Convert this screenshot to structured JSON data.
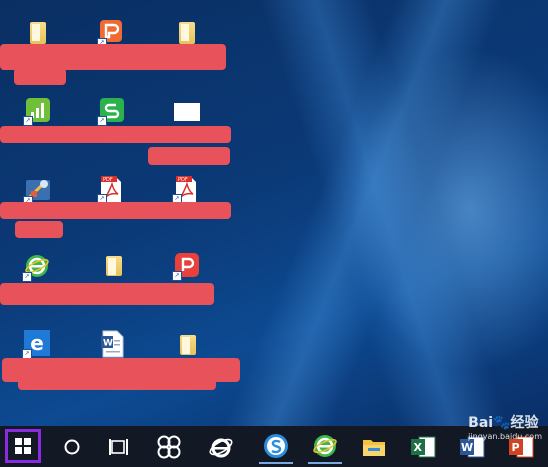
{
  "desktop": {
    "icons": [
      {
        "name": "folder",
        "shortcut": false
      },
      {
        "name": "wps-writer",
        "shortcut": true
      },
      {
        "name": "folder",
        "shortcut": false
      },
      {
        "name": "wps-charts",
        "shortcut": true
      },
      {
        "name": "wps-spreadsheets",
        "shortcut": true
      },
      {
        "name": "blank-document",
        "shortcut": false
      },
      {
        "name": "tools-app",
        "shortcut": true
      },
      {
        "name": "pdf-file",
        "shortcut": true
      },
      {
        "name": "pdf-file",
        "shortcut": true
      },
      {
        "name": "browser-green-e",
        "shortcut": true
      },
      {
        "name": "folder",
        "shortcut": false
      },
      {
        "name": "wps-pdf",
        "shortcut": true
      },
      {
        "name": "internet-explorer",
        "shortcut": true
      },
      {
        "name": "word-document",
        "shortcut": false
      },
      {
        "name": "folder",
        "shortcut": false
      }
    ],
    "redaction_color": "#e8525a"
  },
  "taskbar": {
    "background": "#121925",
    "start_highlight": "#8a2be2",
    "items": [
      {
        "name": "start-button"
      },
      {
        "name": "cortana-search"
      },
      {
        "name": "task-view"
      },
      {
        "name": "pinwheel-app"
      },
      {
        "name": "internet-explorer"
      },
      {
        "name": "sogou-browser"
      },
      {
        "name": "browser-green-e"
      },
      {
        "name": "file-explorer"
      },
      {
        "name": "excel"
      },
      {
        "name": "word"
      },
      {
        "name": "powerpoint"
      }
    ]
  },
  "watermark": {
    "brand": "Bai",
    "brand_cn": "经验",
    "url": "jingyan.baidu.com"
  }
}
